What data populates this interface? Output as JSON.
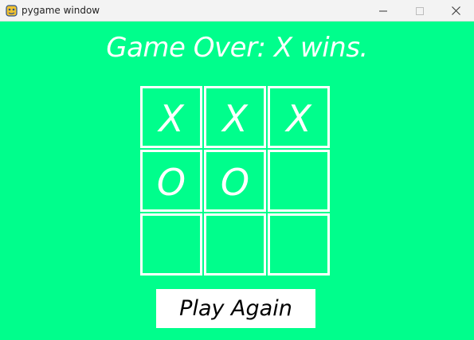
{
  "window": {
    "title": "pygame window",
    "icon": "pygame-snake-icon",
    "controls": {
      "minimize_icon": "minimize-icon",
      "maximize_icon": "maximize-icon",
      "close_icon": "close-icon"
    }
  },
  "game": {
    "status": "Game Over: X wins.",
    "board": [
      [
        "X",
        "X",
        "X"
      ],
      [
        "O",
        "O",
        ""
      ],
      [
        "",
        "",
        ""
      ]
    ],
    "play_again_label": "Play Again"
  },
  "colors": {
    "background": "#00fe8c",
    "foreground": "#ffffff",
    "button_text": "#000000",
    "titlebar": "#f3f3f3"
  }
}
